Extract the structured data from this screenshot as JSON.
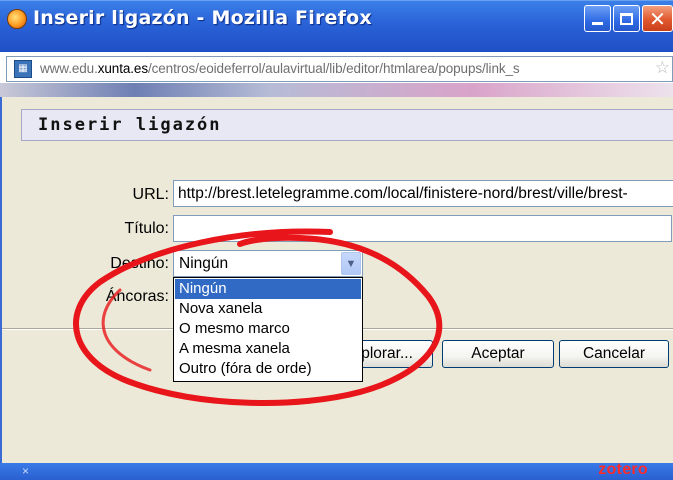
{
  "window": {
    "title": "Inserir ligazón - Mozilla Firefox",
    "address_prefix": "www.edu.",
    "address_domain": "xunta.es",
    "address_path": "/centros/eoideferrol/aulavirtual/lib/editor/htmlarea/popups/link_s"
  },
  "dialog": {
    "heading": "Inserir ligazón",
    "url_label": "URL:",
    "url_value": "http://brest.letelegramme.com/local/finistere-nord/brest/ville/brest-",
    "title_label": "Título:",
    "title_value": "",
    "target_label": "Destino:",
    "target_selected": "Ningún",
    "target_options": [
      "Ningún",
      "Nova xanela",
      "O mesmo marco",
      "A mesma xanela",
      "Outro (fóra de orde)"
    ],
    "anchors_label": "Áncoras:",
    "browse_label": "Explorar...",
    "ok_label": "Aceptar",
    "cancel_label": "Cancelar"
  },
  "statusbar": {
    "close_glyph": "×",
    "zotero": "zotero"
  },
  "colors": {
    "titlebar": "#2a62d8",
    "dialog_bg": "#ece9d8",
    "selection": "#316ac5",
    "annotation": "#e8161a"
  }
}
